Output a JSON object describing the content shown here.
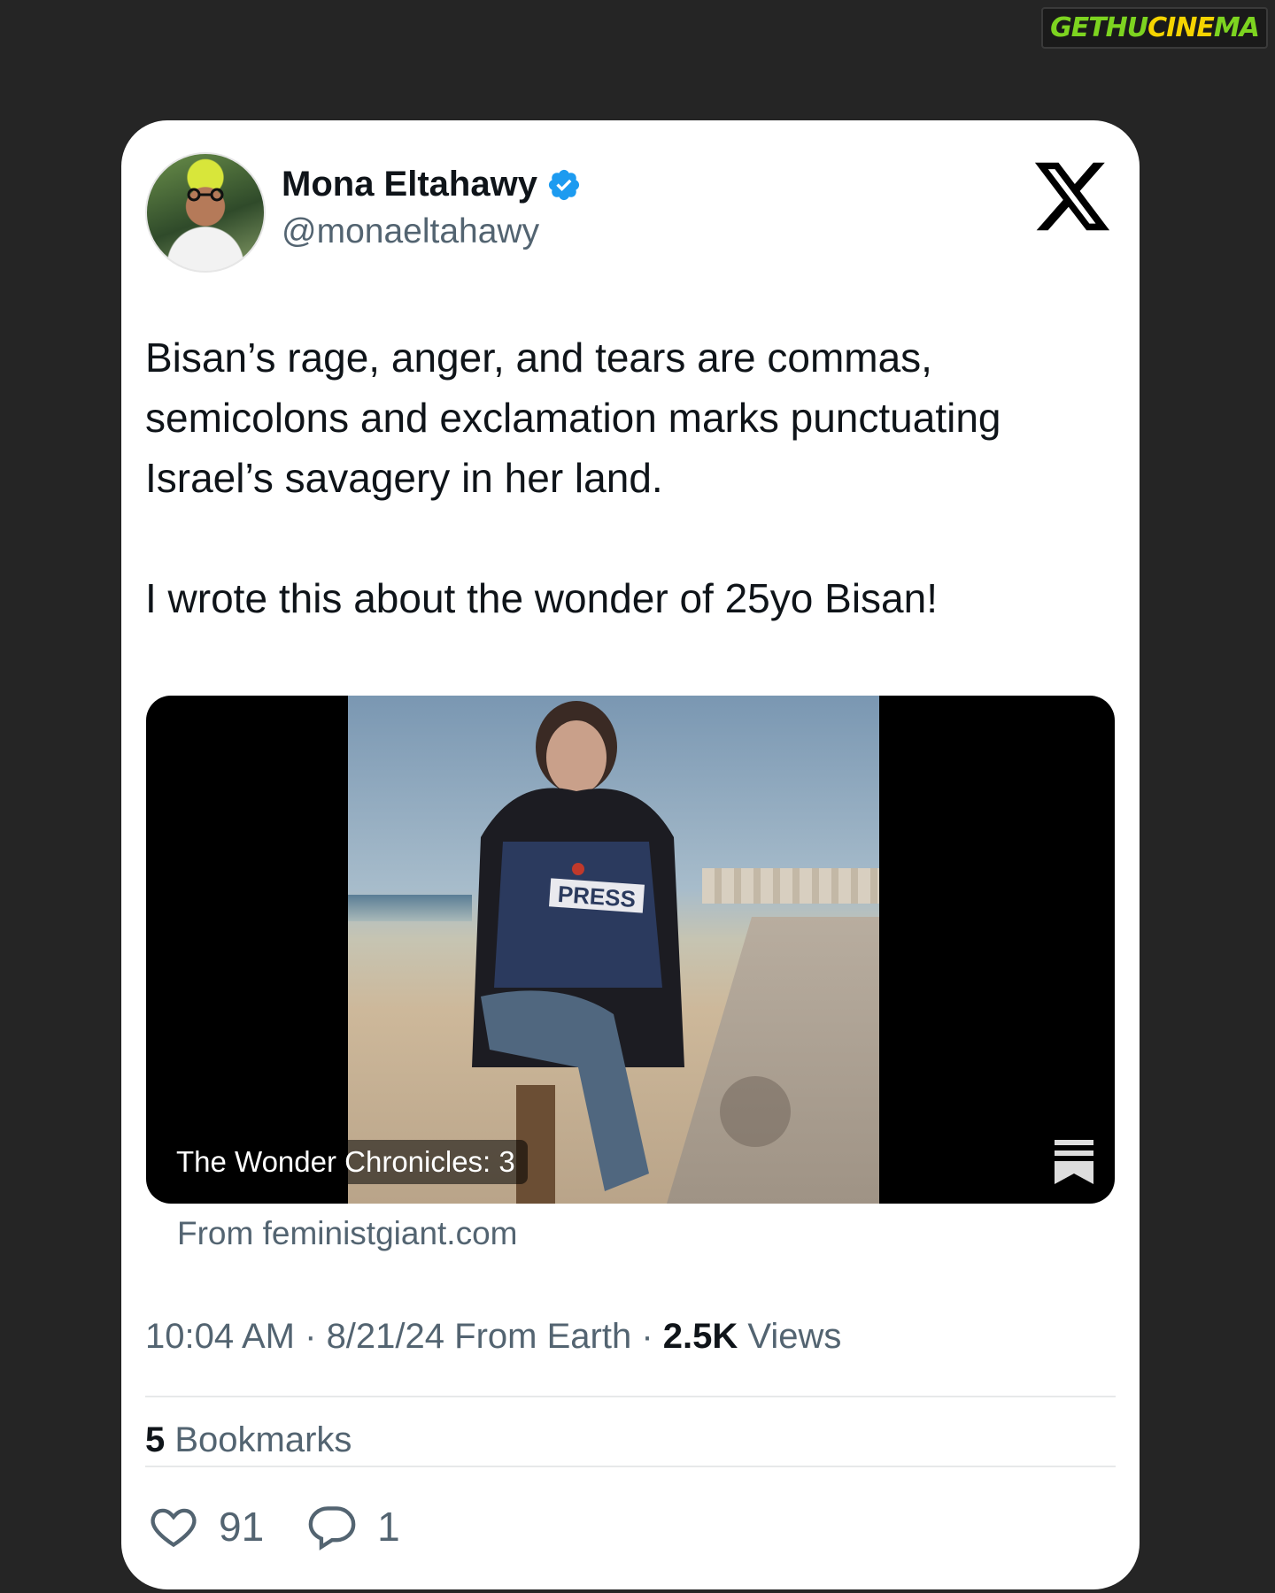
{
  "watermark": {
    "part1": "GETHU",
    "part2": "CINE",
    "part3": "MA"
  },
  "author": {
    "name": "Mona Eltahawy",
    "handle": "@monaeltahawy",
    "verified": true
  },
  "tweet": {
    "paragraph1": "Bisan’s rage, anger, and tears are commas, semicolons and exclamation marks punctuating Israel’s savagery in her land.",
    "paragraph2": "I wrote this about the wonder of 25yo Bisan!"
  },
  "media": {
    "title": "The Wonder Chronicles: 3",
    "press_label": "PRESS",
    "source": "From feministgiant.com"
  },
  "meta": {
    "time": "10:04 AM",
    "date": "8/21/24",
    "origin": "From Earth",
    "views_count": "2.5K",
    "views_label": "Views"
  },
  "bookmarks": {
    "count": "5",
    "label": "Bookmarks"
  },
  "actions": {
    "likes": "91",
    "replies": "1"
  },
  "colors": {
    "background": "#252525",
    "card": "#ffffff",
    "text_primary": "#0f1419",
    "text_secondary": "#536471",
    "verified_blue": "#1d9bf0"
  },
  "icons": [
    "x-logo-icon",
    "verified-badge-icon",
    "bookmark-icon",
    "heart-icon",
    "reply-icon"
  ]
}
